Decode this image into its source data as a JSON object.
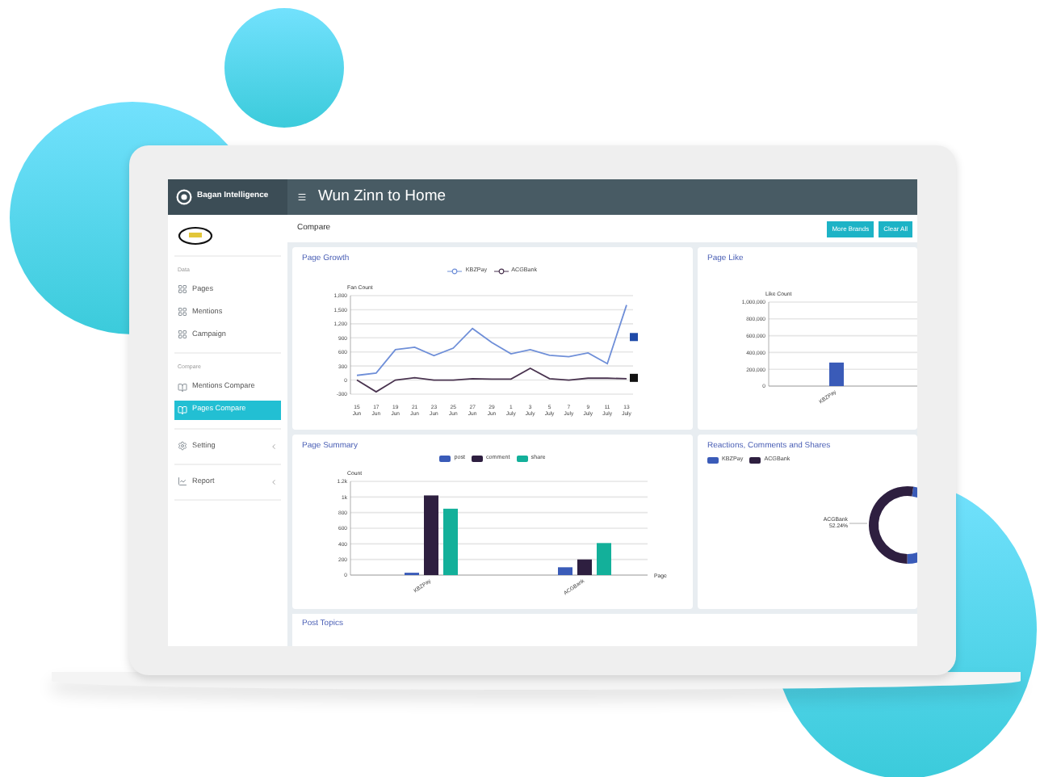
{
  "app": {
    "brand": "Bagan Intelligence",
    "title": "Wun Zinn to Home"
  },
  "sidebar": {
    "sections": [
      {
        "heading": "Data",
        "items": [
          {
            "label": "Pages",
            "selected": false
          },
          {
            "label": "Mentions",
            "selected": false
          },
          {
            "label": "Campaign",
            "selected": false
          }
        ]
      },
      {
        "heading": "Compare",
        "items": [
          {
            "label": "Mentions Compare",
            "selected": false
          },
          {
            "label": "Pages Compare",
            "selected": true
          }
        ]
      }
    ],
    "menus": [
      {
        "label": "Setting",
        "expanded": false
      },
      {
        "label": "Report",
        "expanded": false
      }
    ]
  },
  "toolbar": {
    "title": "Compare",
    "buttons": [
      "More Brands",
      "Clear All"
    ]
  },
  "page_growth": {
    "title": "Page Growth",
    "chart_data": {
      "type": "line",
      "ylabel": "Fan Count",
      "grid": true,
      "ylim": [
        -300,
        1800
      ],
      "categories": [
        "15 Jun",
        "17 Jun",
        "19 Jun",
        "21 Jun",
        "23 Jun",
        "25 Jun",
        "27 Jun",
        "29 Jun",
        "1 July",
        "3 July",
        "5 July",
        "7 July",
        "9 July",
        "11 July",
        "13 July"
      ],
      "series": [
        {
          "name": "KBZPay",
          "color": "#6f8fd8",
          "values": [
            100,
            150,
            650,
            700,
            520,
            680,
            1100,
            800,
            560,
            650,
            530,
            500,
            580,
            350,
            1600
          ]
        },
        {
          "name": "ACGBank",
          "color": "#4a3450",
          "values": [
            0,
            -250,
            0,
            50,
            0,
            0,
            30,
            20,
            20,
            250,
            30,
            0,
            40,
            40,
            30
          ]
        }
      ],
      "yticks": [
        {
          "value": -300,
          "label": "-300"
        },
        {
          "value": 0,
          "label": "0"
        },
        {
          "value": 300,
          "label": "300"
        },
        {
          "value": 600,
          "label": "600"
        },
        {
          "value": 900,
          "label": "900"
        },
        {
          "value": 1200,
          "label": "1,200"
        },
        {
          "value": 1500,
          "label": "1,500"
        },
        {
          "value": 1800,
          "label": "1,800"
        }
      ]
    }
  },
  "page_like": {
    "title": "Page Like",
    "chart_data": {
      "type": "bar",
      "ylabel": "Like Count",
      "grid": true,
      "ylim": [
        0,
        1000000
      ],
      "categories": [
        "KBZPay"
      ],
      "series": [
        {
          "color": "#3a5bb8",
          "values": [
            280000
          ]
        }
      ],
      "yticks": [
        {
          "value": 0,
          "label": "0"
        },
        {
          "value": 200000,
          "label": "200,000"
        },
        {
          "value": 400000,
          "label": "400,000"
        },
        {
          "value": 600000,
          "label": "600,000"
        },
        {
          "value": 800000,
          "label": "800,000"
        },
        {
          "value": 1000000,
          "label": "1,000,000"
        }
      ]
    }
  },
  "page_summary": {
    "title": "Page Summary",
    "chart_data": {
      "type": "bar",
      "xlabel": "Page",
      "ylabel": "Count",
      "grid": true,
      "ylim": [
        0,
        1200
      ],
      "categories": [
        "KBZPay",
        "ACGBank"
      ],
      "series": [
        {
          "name": "post",
          "color": "#3a5bb8",
          "values": [
            30,
            100
          ]
        },
        {
          "name": "comment",
          "color": "#2e1f40",
          "values": [
            1020,
            200
          ]
        },
        {
          "name": "share",
          "color": "#13b09a",
          "values": [
            850,
            410
          ]
        }
      ],
      "yticks": [
        {
          "value": 0,
          "label": "0"
        },
        {
          "value": 200,
          "label": "200"
        },
        {
          "value": 400,
          "label": "400"
        },
        {
          "value": 600,
          "label": "600"
        },
        {
          "value": 800,
          "label": "800"
        },
        {
          "value": 1000,
          "label": "1k"
        },
        {
          "value": 1200,
          "label": "1.2k"
        }
      ]
    }
  },
  "reactions": {
    "title": "Reactions, Comments and Shares",
    "chart_data": {
      "type": "donut",
      "categories": [
        "KBZPay",
        "ACGBank"
      ],
      "values": [
        47.76,
        52.24
      ],
      "colors": [
        "#3a5bb8",
        "#2e1f40"
      ]
    },
    "callout": [
      "ACGBank",
      "52.24%"
    ]
  },
  "post_topics": {
    "title": "Post Topics"
  }
}
